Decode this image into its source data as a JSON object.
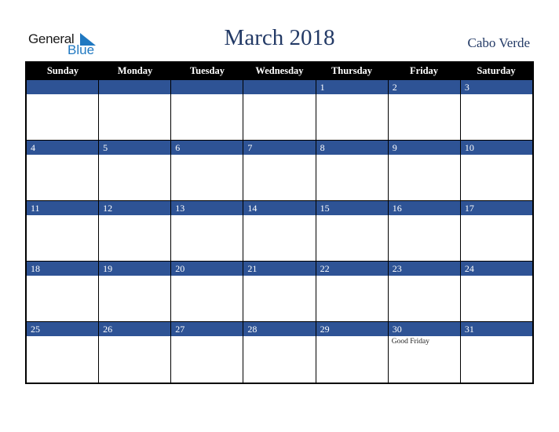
{
  "brand": {
    "word1": "General",
    "word2": "Blue",
    "accent": "#1f78c1"
  },
  "title": "March 2018",
  "country": "Cabo Verde",
  "colors": {
    "header_bg": "#000000",
    "date_bar": "#2e5395",
    "title": "#233a66"
  },
  "weekdays": [
    "Sunday",
    "Monday",
    "Tuesday",
    "Wednesday",
    "Thursday",
    "Friday",
    "Saturday"
  ],
  "weeks": [
    [
      {
        "d": ""
      },
      {
        "d": ""
      },
      {
        "d": ""
      },
      {
        "d": ""
      },
      {
        "d": "1"
      },
      {
        "d": "2"
      },
      {
        "d": "3"
      }
    ],
    [
      {
        "d": "4"
      },
      {
        "d": "5"
      },
      {
        "d": "6"
      },
      {
        "d": "7"
      },
      {
        "d": "8"
      },
      {
        "d": "9"
      },
      {
        "d": "10"
      }
    ],
    [
      {
        "d": "11"
      },
      {
        "d": "12"
      },
      {
        "d": "13"
      },
      {
        "d": "14"
      },
      {
        "d": "15"
      },
      {
        "d": "16"
      },
      {
        "d": "17"
      }
    ],
    [
      {
        "d": "18"
      },
      {
        "d": "19"
      },
      {
        "d": "20"
      },
      {
        "d": "21"
      },
      {
        "d": "22"
      },
      {
        "d": "23"
      },
      {
        "d": "24"
      }
    ],
    [
      {
        "d": "25"
      },
      {
        "d": "26"
      },
      {
        "d": "27"
      },
      {
        "d": "28"
      },
      {
        "d": "29"
      },
      {
        "d": "30",
        "event": "Good Friday"
      },
      {
        "d": "31"
      }
    ]
  ]
}
